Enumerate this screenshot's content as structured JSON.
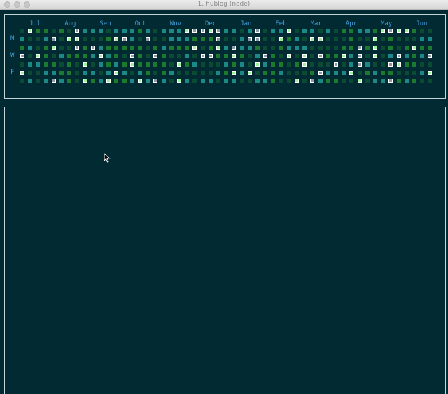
{
  "window": {
    "title": "1. hublog (node)"
  },
  "heatmap": {
    "months": [
      "Jul",
      "Aug",
      "Sep",
      "Oct",
      "Nov",
      "Dec",
      "Jan",
      "Feb",
      "Mar",
      "Apr",
      "May",
      "Jun"
    ],
    "days": [
      "M",
      "W",
      "F"
    ],
    "weeks": 53,
    "levels": [
      "0411010322202221202224334322023022402202011221434410",
      "2002304400014320300222111300233004120440001004010002",
      "1201400313211111012111401423221001222000011314010141",
      "3041021112421031031002033114102310404031142304023212",
      "0221101040212141111041200021204211014000302320034110",
      "4002211022024202101200000214240112000132224012110002",
      "0202321041241124232042022022002210040321100402231210"
    ],
    "colors": {
      "level0": "#0b4a33",
      "level1": "#1c7a2f",
      "level2": "#1b8a86",
      "level3": "#8a9aa6",
      "level4": "#9ef09a"
    }
  }
}
